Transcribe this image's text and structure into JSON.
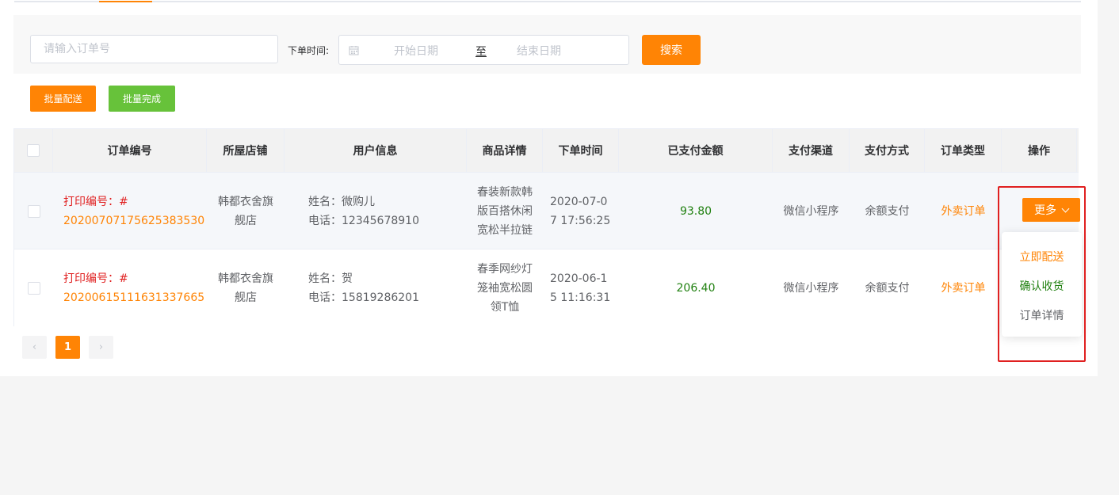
{
  "search": {
    "order_placeholder": "请输入订单号",
    "time_label": "下单时间:",
    "start_placeholder": "开始日期",
    "range_separator": "至",
    "end_placeholder": "结束日期",
    "search_label": "搜索"
  },
  "batch": {
    "send_label": "批量配送",
    "complete_label": "批量完成"
  },
  "table": {
    "headers": [
      "订单编号",
      "所屋店铺",
      "用户信息",
      "商品详情",
      "下单时间",
      "已支付金额",
      "支付渠道",
      "支付方式",
      "订单类型",
      "操作"
    ],
    "rows": [
      {
        "print_label": "打印编号：#",
        "order_no": "20200707175625383530",
        "store": "韩都衣舍旗舰店",
        "user_name": "姓名：微购儿",
        "user_phone": "电话：12345678910",
        "product": "春装新款韩版百搭休闲宽松半拉链",
        "time": "2020-07-07 17:56:25",
        "amount": "93.80",
        "channel": "微信小程序",
        "pay_method": "余额支付",
        "order_type": "外卖订单"
      },
      {
        "print_label": "打印编号：#",
        "order_no": "20200615111631337665",
        "store": "韩都衣舍旗舰店",
        "user_name": "姓名：贺",
        "user_phone": "电话：15819286201",
        "product": "春季网纱灯笼袖宽松圆领T恤",
        "time": "2020-06-15 11:16:31",
        "amount": "206.40",
        "channel": "微信小程序",
        "pay_method": "余额支付",
        "order_type": "外卖订单"
      }
    ]
  },
  "actions": {
    "more_label": "更多",
    "menu": [
      "立即配送",
      "确认收货",
      "订单详情"
    ]
  },
  "pagination": {
    "prev": "‹",
    "current": "1",
    "next": "›"
  },
  "colors": {
    "accent": "#ff8405",
    "success": "#67c23a",
    "danger": "#e02020",
    "amount": "#208010"
  }
}
